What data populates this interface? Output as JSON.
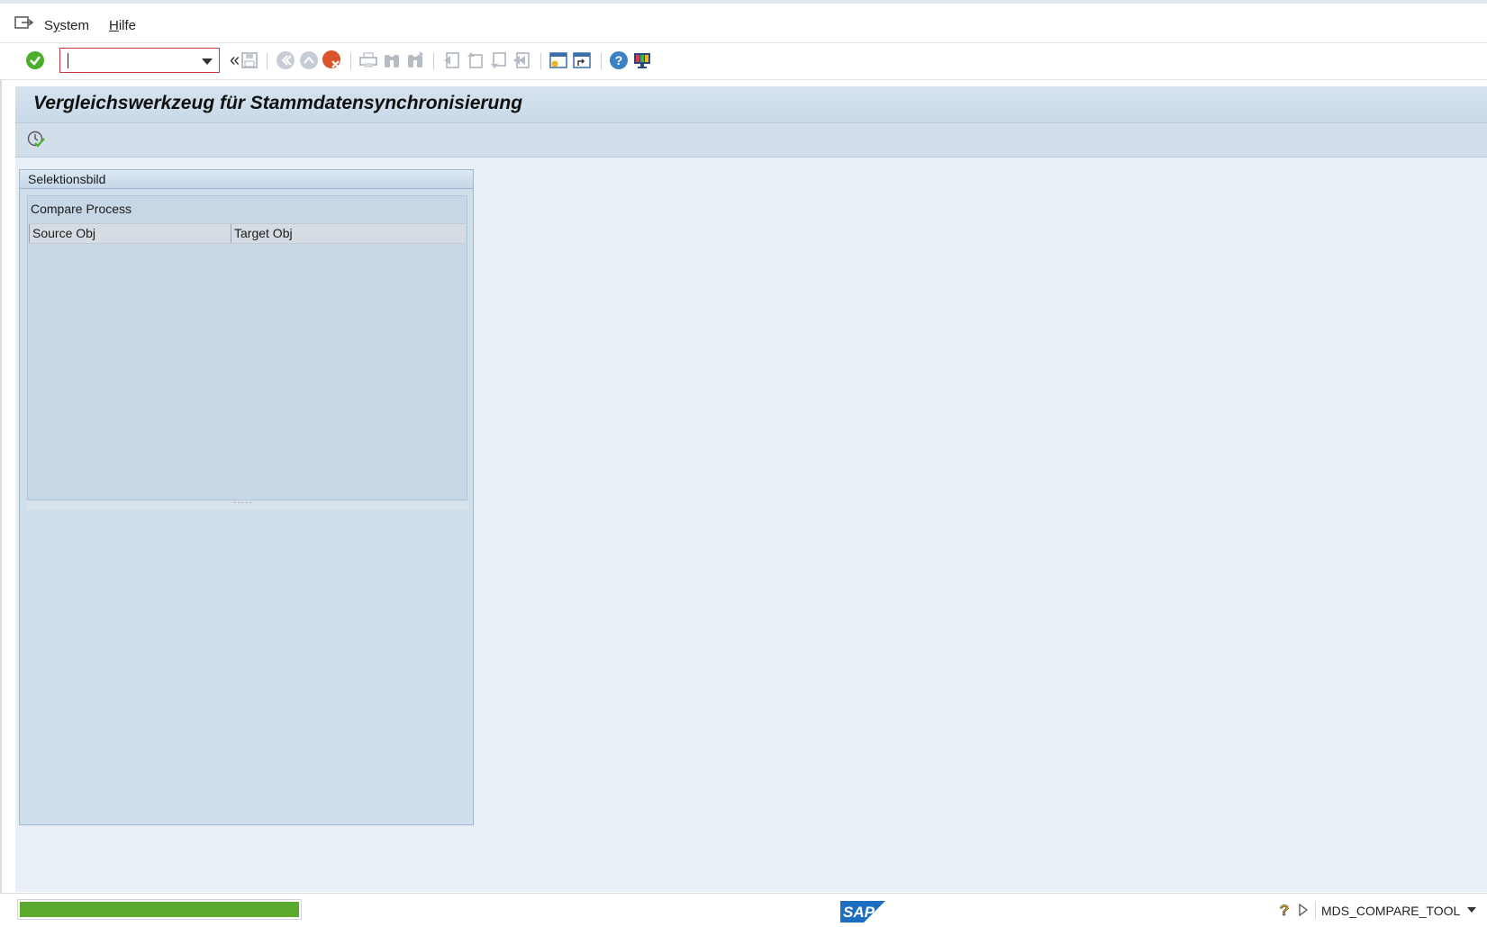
{
  "menu": {
    "items": [
      {
        "label": "System"
      },
      {
        "label": "Hilfe"
      }
    ]
  },
  "toolbar": {
    "command_field": {
      "value": "",
      "placeholder": ""
    },
    "icons": [
      "enter-icon",
      "back-arrows-icon",
      "save-icon",
      "back-icon",
      "exit-icon",
      "cancel-icon",
      "print-icon",
      "find-icon",
      "find-next-icon",
      "first-page-icon",
      "previous-page-icon",
      "next-page-icon",
      "last-page-icon",
      "create-session-icon",
      "shortcut-icon",
      "help-icon",
      "customize-layout-icon"
    ]
  },
  "page": {
    "title": "Vergleichswerkzeug für Stammdatensynchronisierung"
  },
  "selection": {
    "header": "Selektionsbild",
    "tree_title": "Compare Process",
    "columns": [
      "Source Obj",
      "Target Obj"
    ]
  },
  "status": {
    "progress": 1.0,
    "system": "MDS_COMPARE_TOOL",
    "logo": "SAP"
  },
  "colors": {
    "accent": "#5aaa2e",
    "title_bg": "#cfdeec",
    "cancel": "#d9532c"
  }
}
